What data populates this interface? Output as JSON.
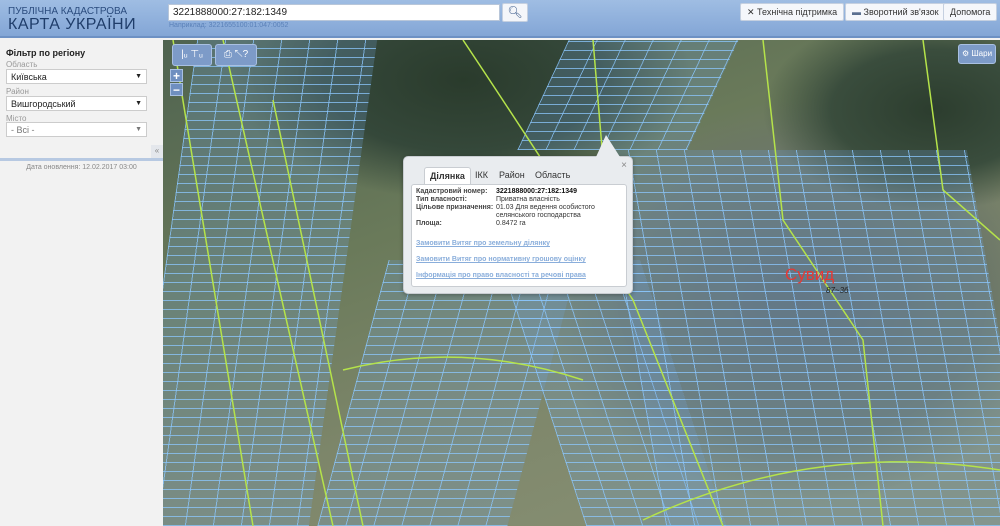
{
  "header": {
    "logo_line1": "ПУБЛІЧНА КАДАСТРОВА",
    "logo_line2": "КАРТА УКРАЇНИ",
    "search_value": "3221888000:27:182:1349",
    "search_hint": "Наприклад: 3221655100:01:047:0052",
    "buttons": {
      "support": "Технічна підтримка",
      "feedback": "Зворотний зв'язок",
      "help": "Допомога"
    }
  },
  "sidebar": {
    "title": "Фільтр по регіону",
    "oblast_label": "Область",
    "oblast_value": "Київська",
    "raion_label": "Район",
    "raion_value": "Вишгородський",
    "misto_label": "Місто",
    "misto_value": "- Всі -",
    "collapse": "«",
    "updated": "Дата оновлення: 12.02.2017 03:00"
  },
  "map": {
    "layers_label": "Шари",
    "zoom_in": "+",
    "zoom_out": "−",
    "town_label": "Сувид",
    "town_sublabel": "87~3б"
  },
  "popup": {
    "tabs": [
      "Ділянка",
      "ІКК",
      "Район",
      "Область"
    ],
    "close": "×",
    "fields": [
      {
        "k": "Кадастровий номер:",
        "v": "3221888000:27:182:1349"
      },
      {
        "k": "Тип власності:",
        "v": "Приватна власність"
      },
      {
        "k": "Цільове призначення:",
        "v": "01.03 Для ведення особистого селянського господарства"
      },
      {
        "k": "Площа:",
        "v": "0.8472 га"
      }
    ],
    "links": [
      "Замовити Витяг про земельну ділянку",
      "Замовити Витяг про нормативну грошову оцінку",
      "Інформація про право власності та речові права"
    ]
  }
}
